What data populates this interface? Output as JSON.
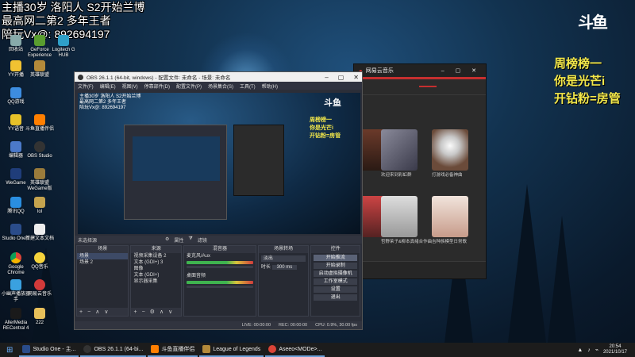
{
  "stream_overlay": {
    "top_lines": [
      "主播30岁 洛阳人 S2开始兰博",
      "最高网二第2 多年王者",
      "陪玩Vx@: 892694197"
    ],
    "right_lines": [
      "周榜榜一",
      "你是光芒i",
      "开钻粉=房管"
    ],
    "logo_text": "斗鱼"
  },
  "desktop_icons": [
    {
      "label": "回收站",
      "icon": "recycle-bin-icon"
    },
    {
      "label": "GeForce Experience",
      "icon": "geforce-icon"
    },
    {
      "label": "Logitech G HUB",
      "icon": "ghub-icon"
    },
    {
      "label": "YY开播",
      "icon": "yy-icon"
    },
    {
      "label": "英雄联盟",
      "icon": "lol-icon"
    },
    {
      "label": "QQ游戏",
      "icon": "qqgame-icon"
    },
    {
      "label": "YY语音",
      "icon": "yy-voice-icon"
    },
    {
      "label": "斗鱼直播伴侣",
      "icon": "douyu-icon"
    },
    {
      "label": "编辑器",
      "icon": "editor-icon"
    },
    {
      "label": "OBS Studio",
      "icon": "obs-icon"
    },
    {
      "label": "WeGame",
      "icon": "wegame-icon"
    },
    {
      "label": "英雄联盟WeGame版",
      "icon": "lol-wegame-icon"
    },
    {
      "label": "腾讯QQ",
      "icon": "qq-icon"
    },
    {
      "label": "lol",
      "icon": "lol-shortcut-icon"
    },
    {
      "label": "Studio One 2",
      "icon": "studio-one-icon"
    },
    {
      "label": "新建文本文档",
      "icon": "text-doc-icon"
    },
    {
      "label": "Google Chrome",
      "icon": "chrome-icon"
    },
    {
      "label": "QQ音乐",
      "icon": "qqmusic-icon"
    },
    {
      "label": "小幽声播放器手",
      "icon": "player-icon"
    },
    {
      "label": "网易云音乐",
      "icon": "netease-icon"
    },
    {
      "label": "AllerMedia RECentral 4",
      "icon": "recentral-icon"
    },
    {
      "label": "222",
      "icon": "folder-icon"
    }
  ],
  "music_window": {
    "title": "网易云音乐",
    "cards": [
      {
        "label": ""
      },
      {
        "label": ""
      },
      {
        "label": ""
      },
      {
        "label": "欢迎来到彩虹群"
      },
      {
        "label": "打游戏必备神曲"
      },
      {
        "label": ""
      },
      {
        "label": "哲野茉子&柳本真绪合作曲"
      },
      {
        "label": "吉种族模型日常歌"
      }
    ]
  },
  "obs": {
    "title": "OBS 26.1.1 (64-bit, windows) - 配置文件: 未命名 - 场景: 未命名",
    "menu": [
      "文件(F)",
      "编辑(E)",
      "视图(V)",
      "停靠部件(D)",
      "配置文件(P)",
      "场景集合(S)",
      "工具(T)",
      "帮助(H)"
    ],
    "scene_label": "未选择源",
    "scene_bar": [
      "属性",
      "滤镜"
    ],
    "docks": {
      "scenes": {
        "title": "场景",
        "items": [
          "场景",
          "场景 2"
        ]
      },
      "sources": {
        "title": "来源",
        "items": [
          "视频采集设备 2",
          "文本 (GDI+) 3",
          "图像",
          "文本 (GDI+)",
          "显示器采集"
        ]
      },
      "mixer": {
        "title": "混音器",
        "items": [
          "麦克风/Aux",
          "桌面音频"
        ]
      },
      "transitions": {
        "title": "场景转场",
        "fade": "淡出",
        "duration_label": "时长",
        "duration_value": "300 ms"
      },
      "controls": {
        "title": "控件",
        "buttons": [
          "开始推流",
          "开始录制",
          "启动虚拟摄像机",
          "工作室模式",
          "设置",
          "退出"
        ]
      }
    },
    "status": [
      "LIVE: 00:00:00",
      "REC: 00:00:00",
      "CPU: 0.9%, 30.00 fps"
    ]
  },
  "taskbar": {
    "items": [
      "Studio One - 主...",
      "OBS 26.1.1 (64-bi...",
      "斗鱼直播伴侣",
      "League of Legends",
      "Aseeo<MODe>..."
    ],
    "time": "20:54",
    "date": "2021/10/17"
  }
}
